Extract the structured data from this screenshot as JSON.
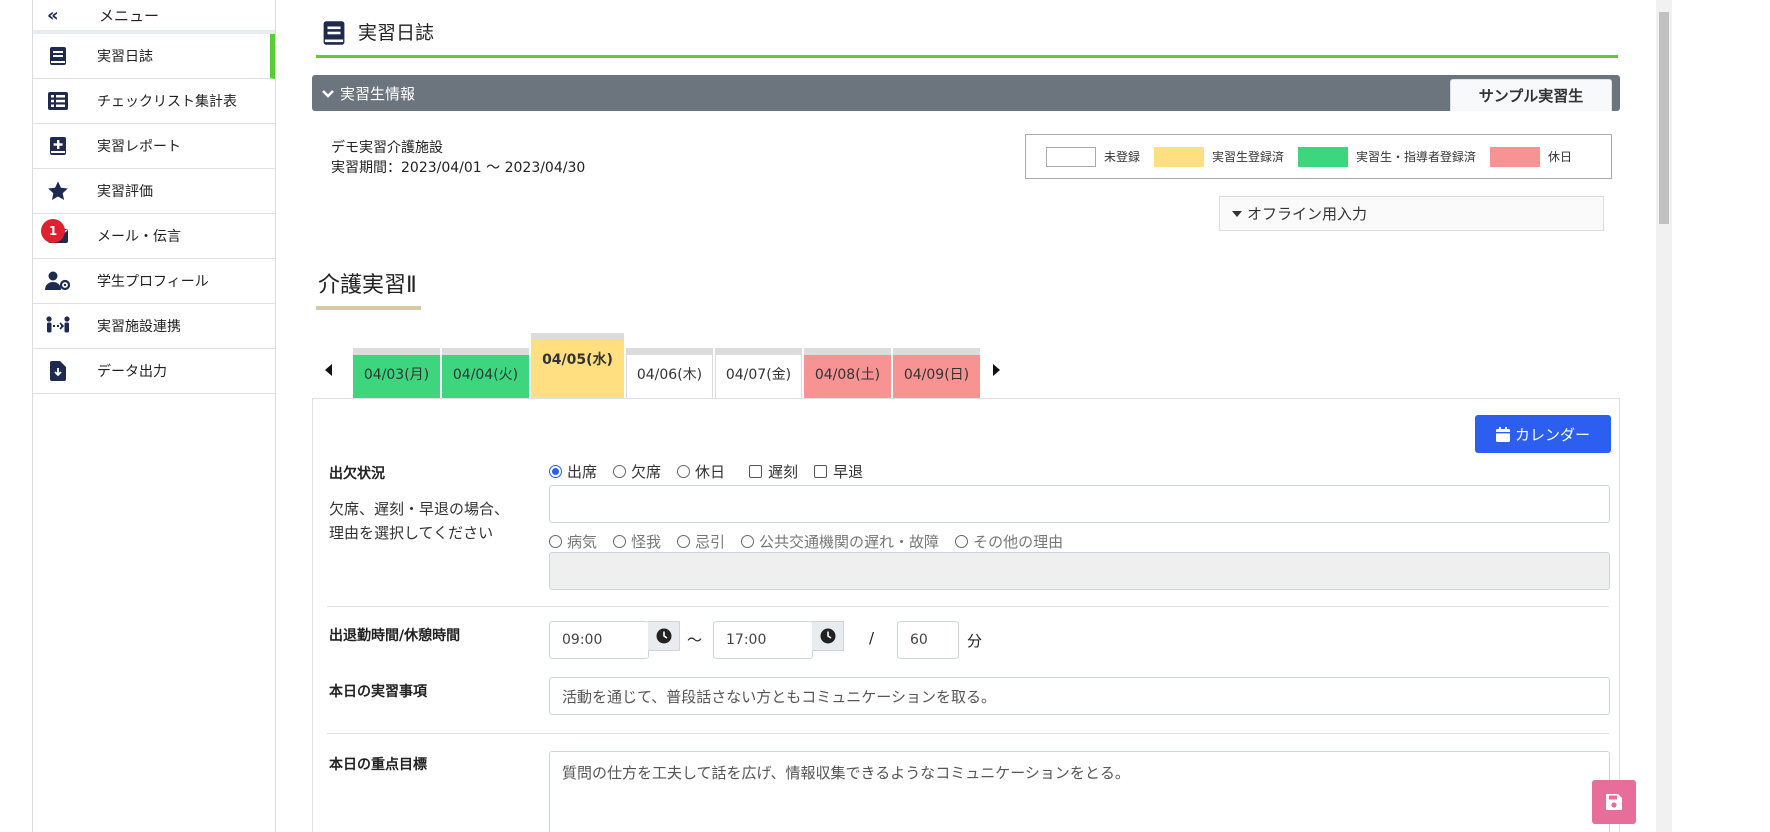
{
  "sidebar": {
    "menu_label": "メニュー",
    "collapse_glyph": "«",
    "items": [
      {
        "label": "実習日誌",
        "icon": "book-icon",
        "active": true
      },
      {
        "label": "チェックリスト集計表",
        "icon": "list-icon"
      },
      {
        "label": "実習レポート",
        "icon": "report-plus-icon"
      },
      {
        "label": "実習評価",
        "icon": "star-icon"
      },
      {
        "label": "メール・伝言",
        "icon": "mail-icon",
        "badge": "1"
      },
      {
        "label": "学生プロフィール",
        "icon": "user-gear-icon"
      },
      {
        "label": "実習施設連携",
        "icon": "people-link-icon"
      },
      {
        "label": "データ出力",
        "icon": "file-download-icon"
      }
    ]
  },
  "header": {
    "title": "実習日誌",
    "info_bar_label": "実習生情報",
    "student_name": "サンプル実習生"
  },
  "facility": {
    "name": "デモ実習介護施設",
    "period": "実習期間：2023/04/01 〜 2023/04/30"
  },
  "legend": [
    {
      "label": "未登録",
      "color": "#ffffff"
    },
    {
      "label": "実習生登録済",
      "color": "#ffdf80"
    },
    {
      "label": "実習生・指導者登録済",
      "color": "#3dd67e"
    },
    {
      "label": "休日",
      "color": "#f79393"
    }
  ],
  "offline_label": "オフライン用入力",
  "section_title": "介護実習Ⅱ",
  "day_tabs": [
    {
      "label": "04/03(月)",
      "status": "both",
      "color": "#3dd67e"
    },
    {
      "label": "04/04(火)",
      "status": "both",
      "color": "#3dd67e"
    },
    {
      "label": "04/05(水)",
      "status": "student",
      "color": "#ffdf80",
      "selected": true
    },
    {
      "label": "04/06(木)",
      "status": "none",
      "color": "#ffffff"
    },
    {
      "label": "04/07(金)",
      "status": "none",
      "color": "#ffffff"
    },
    {
      "label": "04/08(土)",
      "status": "holiday",
      "color": "#f79393"
    },
    {
      "label": "04/09(日)",
      "status": "holiday",
      "color": "#f79393"
    }
  ],
  "calendar_button": "カレンダー",
  "attendance": {
    "label": "出欠状況",
    "options": [
      "出席",
      "欠席",
      "休日"
    ],
    "selected": "出席",
    "checks": [
      "遅刻",
      "早退"
    ],
    "note": "欠席、遅刻・早退の場合、理由を選択してください",
    "reasons": [
      "病気",
      "怪我",
      "忌引",
      "公共交通機関の遅れ・故障",
      "その他の理由"
    ]
  },
  "hours": {
    "label": "出退勤時間/休憩時間",
    "start": "09:00",
    "tilde": "〜",
    "end": "17:00",
    "slash": "/",
    "break": "60",
    "unit": "分"
  },
  "today_item": {
    "label": "本日の実習事項",
    "value": "活動を通じて、普段話さない方ともコミュニケーションを取る。"
  },
  "today_goal": {
    "label": "本日の重点目標",
    "value": "質問の仕方を工夫して話を広げ、情報収集できるようなコミュニケーションをとる。"
  },
  "colors": {
    "accent_green": "#5fcb33",
    "primary_blue": "#2c5ff0",
    "save_pink": "#e66e98",
    "navy_icon": "#1e2a50"
  }
}
